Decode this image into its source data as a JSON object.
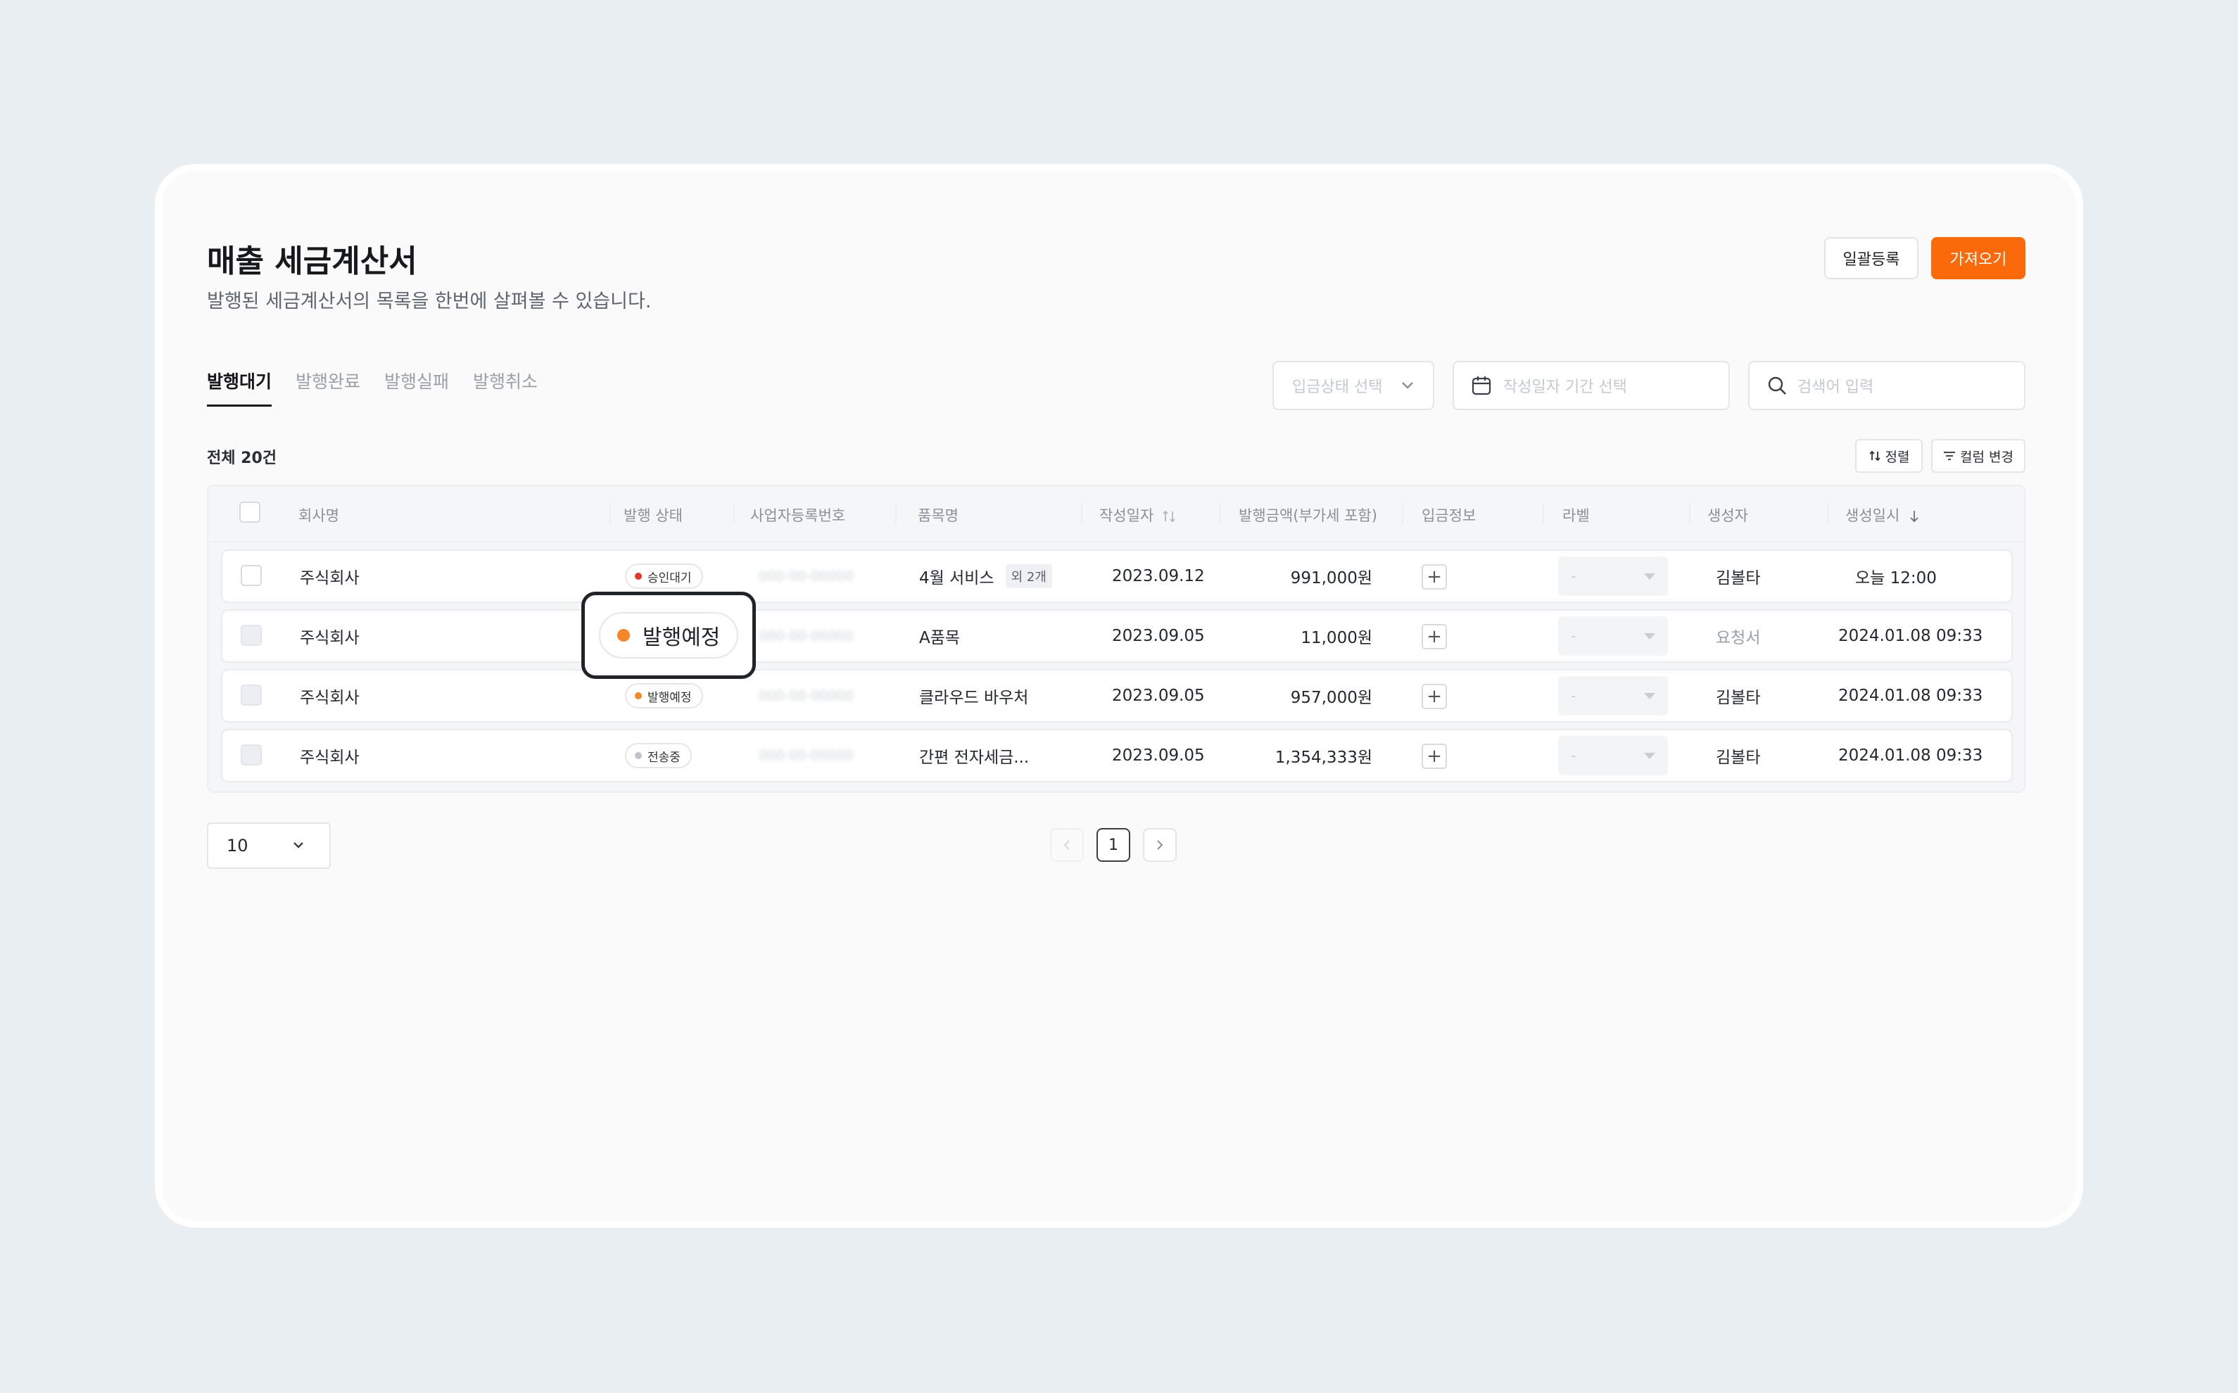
{
  "header": {
    "title": "매출 세금계산서",
    "subtitle": "발행된 세금계산서의 목록을 한번에 살펴볼 수 있습니다.",
    "bulk_register_label": "일괄등록",
    "import_label": "가져오기"
  },
  "tabs": [
    {
      "label": "발행대기",
      "active": true
    },
    {
      "label": "발행완료",
      "active": false
    },
    {
      "label": "발행실패",
      "active": false
    },
    {
      "label": "발행취소",
      "active": false
    }
  ],
  "filters": {
    "deposit_status_placeholder": "입금상태 선택",
    "date_range_placeholder": "작성일자 기간 선택",
    "search_placeholder": "검색어 입력"
  },
  "list": {
    "total_label": "전체 20건",
    "sort_label": "정렬",
    "columns_label": "컬럼 변경"
  },
  "table": {
    "headers": {
      "company": "회사명",
      "status": "발행 상태",
      "biz_no": "사업자등록번호",
      "item": "품목명",
      "date": "작성일자",
      "amount": "발행금액(부가세 포함)",
      "deposit": "입금정보",
      "label": "라벨",
      "creator": "생성자",
      "created_at": "생성일시"
    },
    "rows": [
      {
        "company": "주식회사",
        "status": "승인대기",
        "status_color": "#e5362c",
        "biz_no": "000-00-00000",
        "item": "4월 서비스",
        "item_extra": "외 2개",
        "date": "2023.09.12",
        "amount": "991,000원",
        "label": "-",
        "creator": "김볼타",
        "created_at": "오늘 12:00",
        "disabled": false
      },
      {
        "company": "주식회사",
        "status": "발행예정",
        "status_color": "#f5862a",
        "biz_no": "000-00-00000",
        "item": "A품목",
        "item_extra": "",
        "date": "2023.09.05",
        "amount": "11,000원",
        "label": "-",
        "creator": "요청서",
        "created_at": "2024.01.08 09:33",
        "disabled": true
      },
      {
        "company": "주식회사",
        "status": "발행예정",
        "status_color": "#f5862a",
        "biz_no": "000-00-00000",
        "item": "클라우드 바우처",
        "item_extra": "",
        "date": "2023.09.05",
        "amount": "957,000원",
        "label": "-",
        "creator": "김볼타",
        "created_at": "2024.01.08 09:33",
        "disabled": true
      },
      {
        "company": "주식회사",
        "status": "전송중",
        "status_color": "#bfc3c8",
        "biz_no": "000-00-00000",
        "item": "간편 전자세금...",
        "item_extra": "",
        "date": "2023.09.05",
        "amount": "1,354,333원",
        "label": "-",
        "creator": "김볼타",
        "created_at": "2024.01.08 09:33",
        "disabled": true
      }
    ]
  },
  "callout": {
    "label": "발행예정",
    "color": "#f5862a"
  },
  "pagination": {
    "page_size": "10",
    "current_page": "1"
  }
}
